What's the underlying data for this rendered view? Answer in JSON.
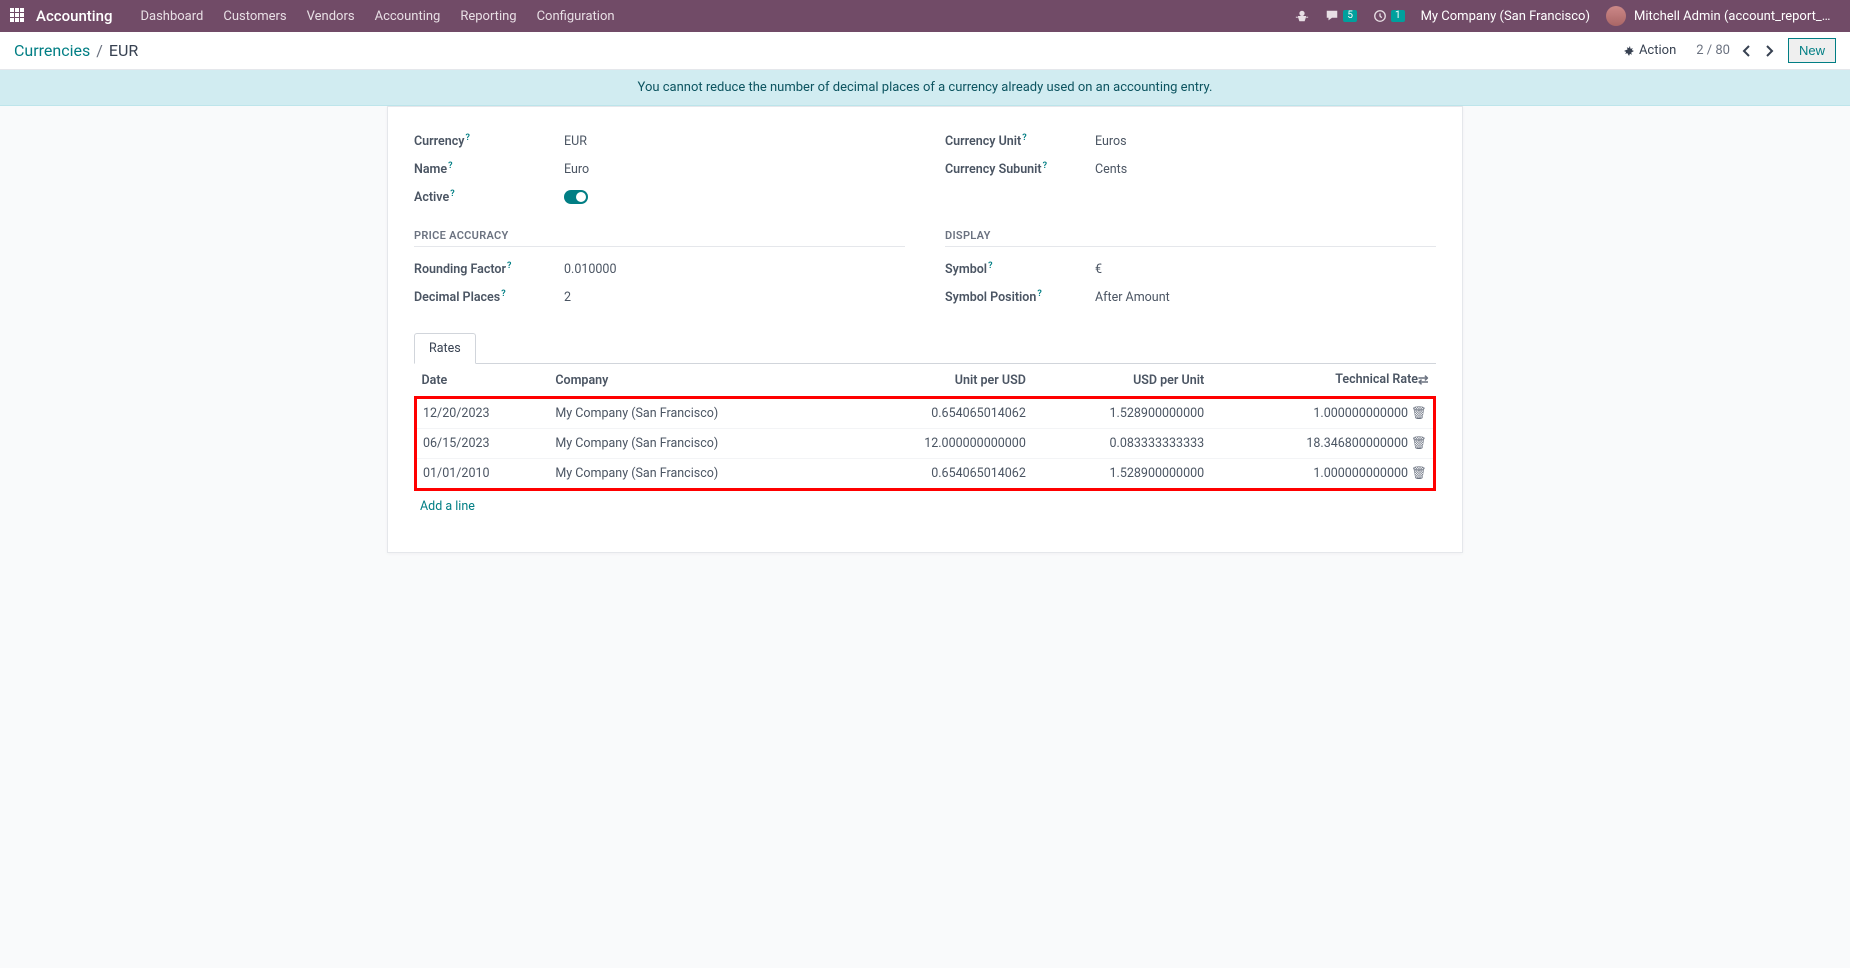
{
  "topnav": {
    "brand": "Accounting",
    "menu": [
      "Dashboard",
      "Customers",
      "Vendors",
      "Accounting",
      "Reporting",
      "Configuration"
    ],
    "messages_badge": "5",
    "activities_badge": "1",
    "company": "My Company (San Francisco)",
    "user": "Mitchell Admin (account_report_multi..."
  },
  "breadcrumb": {
    "parent": "Currencies",
    "current": "EUR"
  },
  "controlbar": {
    "action": "Action",
    "pager": "2 / 80",
    "new": "New"
  },
  "notification": "You cannot reduce the number of decimal places of a currency already used on an accounting entry.",
  "form": {
    "currency_label": "Currency",
    "currency_value": "EUR",
    "name_label": "Name",
    "name_value": "Euro",
    "active_label": "Active",
    "unit_label": "Currency Unit",
    "unit_value": "Euros",
    "subunit_label": "Currency Subunit",
    "subunit_value": "Cents",
    "section_price": "PRICE ACCURACY",
    "rounding_label": "Rounding Factor",
    "rounding_value": "0.010000",
    "decimal_label": "Decimal Places",
    "decimal_value": "2",
    "section_display": "DISPLAY",
    "symbol_label": "Symbol",
    "symbol_value": "€",
    "position_label": "Symbol Position",
    "position_value": "After Amount"
  },
  "tabs": {
    "rates": "Rates"
  },
  "table": {
    "headers": {
      "date": "Date",
      "company": "Company",
      "unit_per": "Unit per USD",
      "usd_per": "USD per Unit",
      "tech": "Technical Rate"
    },
    "rows": [
      {
        "date": "12/20/2023",
        "company": "My Company (San Francisco)",
        "unit_per": "0.654065014062",
        "usd_per": "1.528900000000",
        "tech": "1.000000000000"
      },
      {
        "date": "06/15/2023",
        "company": "My Company (San Francisco)",
        "unit_per": "12.000000000000",
        "usd_per": "0.083333333333",
        "tech": "18.346800000000"
      },
      {
        "date": "01/01/2010",
        "company": "My Company (San Francisco)",
        "unit_per": "0.654065014062",
        "usd_per": "1.528900000000",
        "tech": "1.000000000000"
      }
    ],
    "add_line": "Add a line"
  }
}
